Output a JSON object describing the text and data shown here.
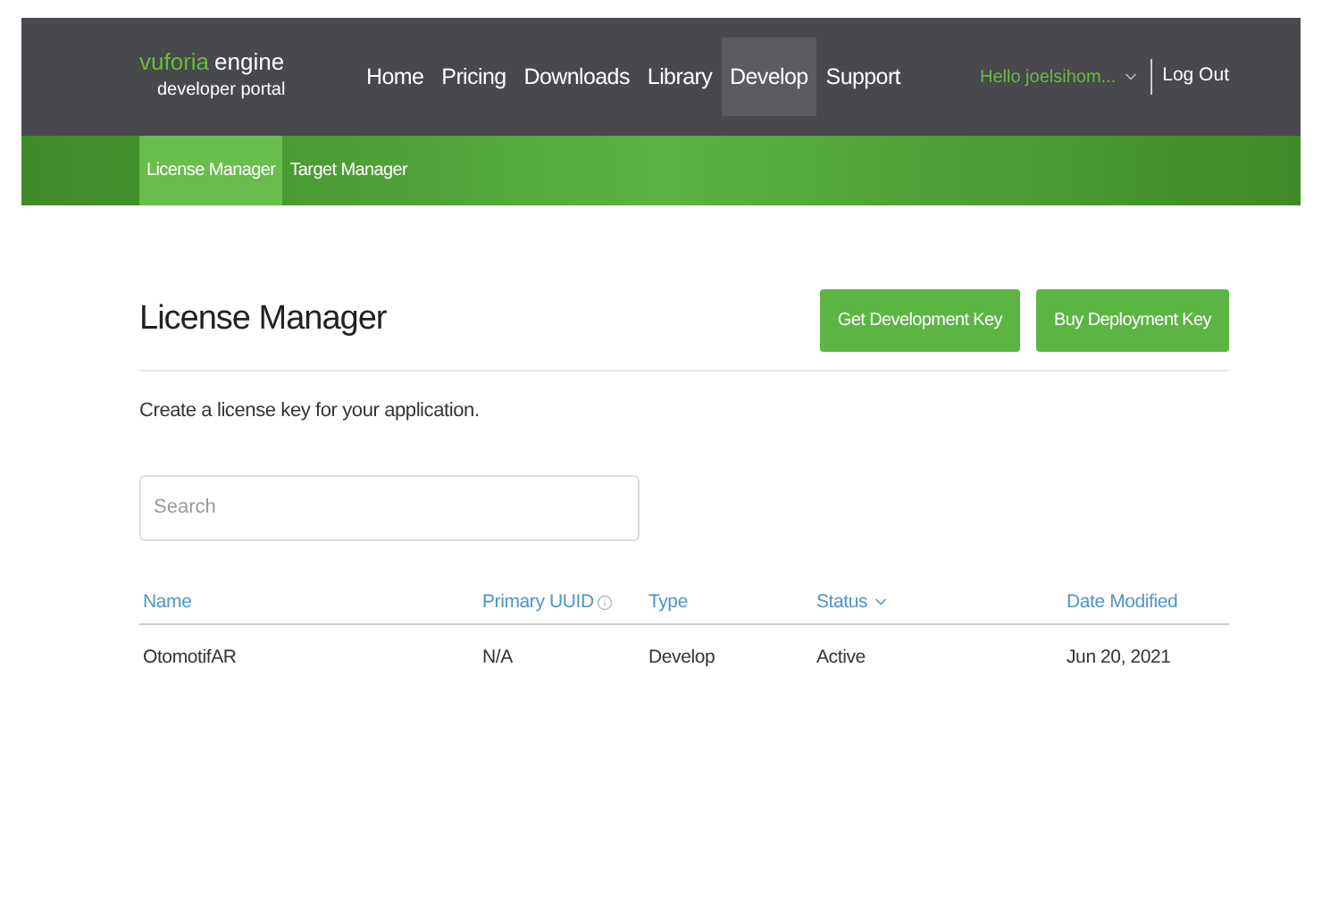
{
  "logo": {
    "brand": "vuforia",
    "product": "engine",
    "tagline": "developer portal"
  },
  "nav": [
    {
      "label": "Home",
      "selected": false
    },
    {
      "label": "Pricing",
      "selected": false
    },
    {
      "label": "Downloads",
      "selected": false
    },
    {
      "label": "Library",
      "selected": false
    },
    {
      "label": "Develop",
      "selected": true
    },
    {
      "label": "Support",
      "selected": false
    }
  ],
  "user": {
    "greeting": "Hello joelsihom...",
    "logout": "Log Out"
  },
  "subnav": [
    {
      "label": "License Manager",
      "selected": true
    },
    {
      "label": "Target Manager",
      "selected": false
    }
  ],
  "page": {
    "title": "License Manager",
    "buttons": [
      "Get Development Key",
      "Buy Deployment Key"
    ],
    "description": "Create a license key for your application."
  },
  "search": {
    "placeholder": "Search"
  },
  "table": {
    "columns": [
      {
        "label": "Name",
        "kind": "plain"
      },
      {
        "label": "Primary UUID",
        "kind": "info"
      },
      {
        "label": "Type",
        "kind": "plain"
      },
      {
        "label": "Status",
        "kind": "sort"
      },
      {
        "label": "Date Modified",
        "kind": "plain"
      }
    ],
    "rows": [
      [
        "OtomotifAR",
        "N/A",
        "Develop",
        "Active",
        "Jun 20, 2021"
      ]
    ]
  }
}
